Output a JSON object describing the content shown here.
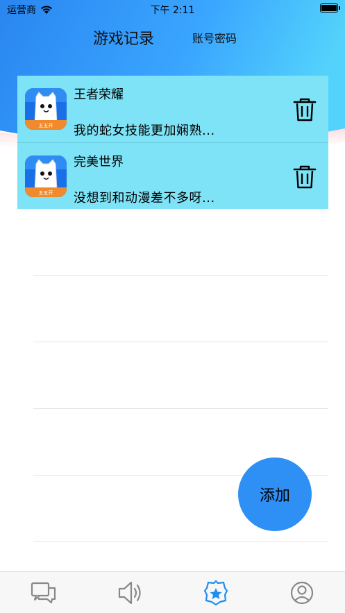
{
  "status_bar": {
    "carrier": "运营商",
    "time": "下午 2:11"
  },
  "header": {
    "tabs": [
      {
        "label": "游戏记录",
        "active": true
      },
      {
        "label": "账号密码",
        "active": false
      }
    ]
  },
  "records": [
    {
      "title": "王者荣耀",
      "message": "我的蛇女技能更加娴熟...",
      "icon": "app-icon-wuwukai",
      "icon_badge": "五五开"
    },
    {
      "title": "完美世界",
      "message": "没想到和动漫差不多呀...",
      "icon": "app-icon-wuwukai",
      "icon_badge": "五五开"
    }
  ],
  "add_button": {
    "label": "添加"
  },
  "tab_bar": {
    "items": [
      {
        "icon": "chat-icon",
        "active": false
      },
      {
        "icon": "speaker-icon",
        "active": false
      },
      {
        "icon": "police-badge-icon",
        "active": true
      },
      {
        "icon": "user-icon",
        "active": false
      }
    ]
  },
  "colors": {
    "header_blue": "#3399ff",
    "card_cyan": "#7ee3f6",
    "fab_blue": "#2e8ff5",
    "active_tab_icon": "#1e8ef0",
    "inactive_tab_icon": "#888888"
  }
}
